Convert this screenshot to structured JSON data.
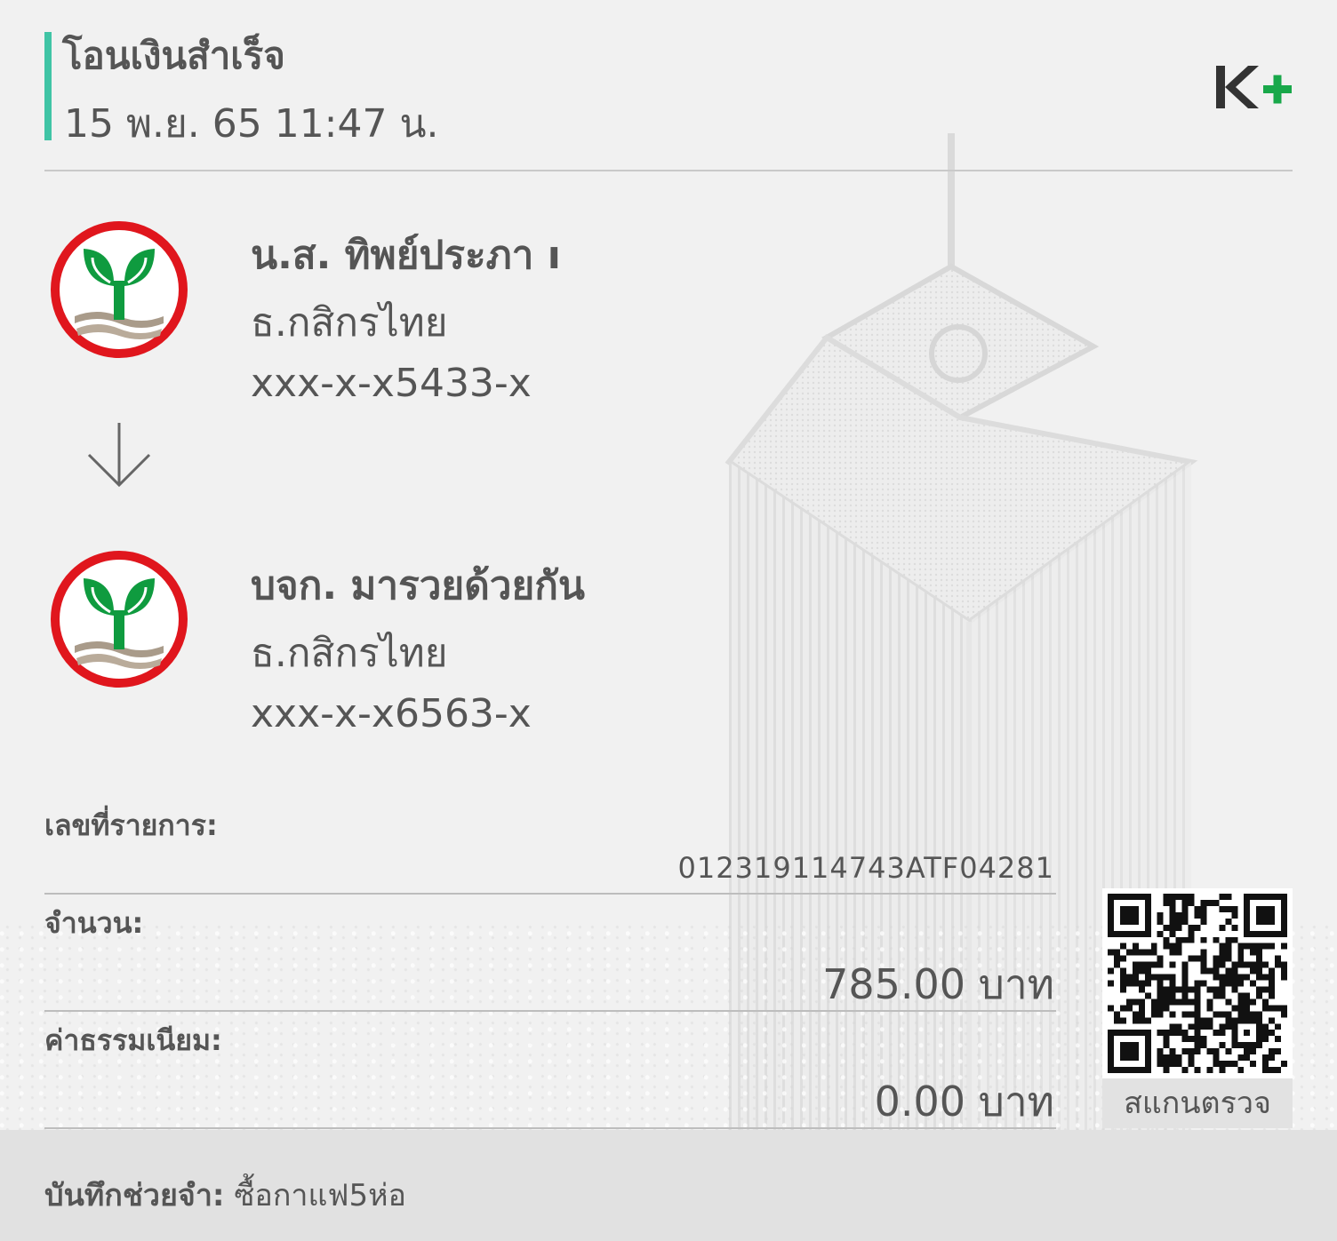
{
  "header": {
    "title": "โอนเงินสำเร็จ",
    "datetime": "15 พ.ย. 65  11:47 น.",
    "logo_text": "K+"
  },
  "sender": {
    "name": "น.ส. ทิพย์ประภา ı",
    "bank": "ธ.กสิกรไทย",
    "account": "xxx-x-x5433-x",
    "logo": "kbank-logo"
  },
  "transfer_arrow": "arrow-down-icon",
  "receiver": {
    "name": "บจก. มารวยด้วยกัน",
    "bank": "ธ.กสิกรไทย",
    "account": "xxx-x-x6563-x",
    "logo": "kbank-logo"
  },
  "details": {
    "transaction_label": "เลขที่รายการ:",
    "transaction_id": "012319114743ATF04281",
    "amount_label": "จำนวน:",
    "amount_value": "785.00 บาท",
    "fee_label": "ค่าธรรมเนียม:",
    "fee_value": "0.00 บาท"
  },
  "qr": {
    "caption": "สแกนตรวจ"
  },
  "memo": {
    "label": "บันทึกช่วยจำ:",
    "value": "ซื้อกาแฟ5ห่อ"
  },
  "colors": {
    "accent": "#40c4a5",
    "kbank_green": "#0f9b3f",
    "kbank_red": "#e0161d",
    "kplus_green": "#19a84a",
    "text": "#555555"
  }
}
